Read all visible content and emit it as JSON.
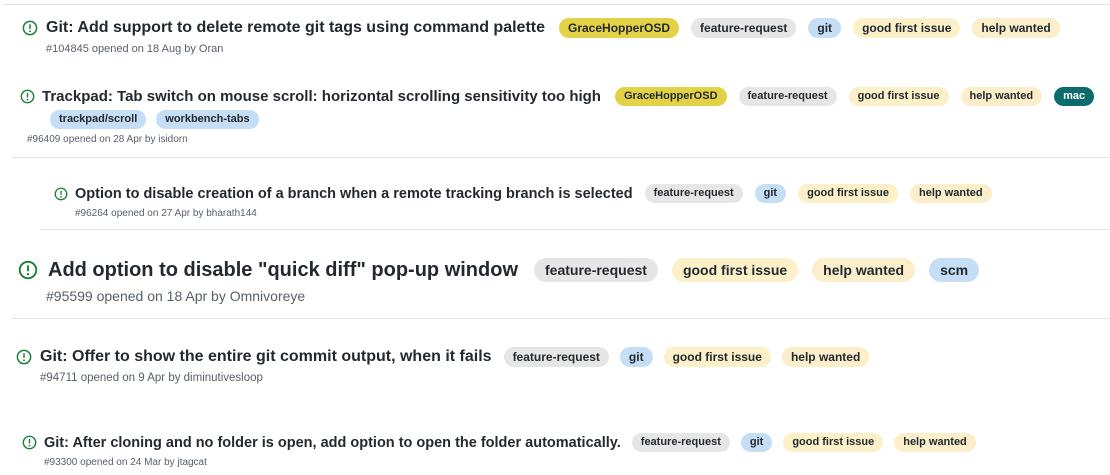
{
  "colors": {
    "open_icon": "#1a7f37",
    "label_gracehopper": "#e4d246",
    "label_feature_request": "#e6e6e6",
    "label_git": "#c5def5",
    "label_good_first_issue": "#fbf0c8",
    "label_help_wanted": "#fbeecb",
    "label_trackpad": "#c5def5",
    "label_workbench_tabs": "#c5def5",
    "label_scm": "#c5def5",
    "label_mac_dark": "#0e6b6b",
    "title_text": "#24292f",
    "meta_text": "#57606a"
  },
  "issues": [
    {
      "icon": "issue-open-icon",
      "title": "Git: Add support to delete remote git tags using command palette",
      "labels": [
        "GraceHopperOSD",
        "feature-request",
        "git",
        "good first issue",
        "help wanted"
      ],
      "meta": "#104845 opened on 18 Aug by Oran"
    },
    {
      "icon": "issue-open-icon",
      "title": "Trackpad: Tab switch on mouse scroll: horizontal scrolling sensitivity too high",
      "labels": [
        "GraceHopperOSD",
        "feature-request",
        "good first issue",
        "help wanted",
        "mac"
      ],
      "labels_second_row": [
        "trackpad/scroll",
        "workbench-tabs"
      ],
      "meta": "#96409 opened on 28 Apr by isidorn"
    },
    {
      "icon": "issue-open-icon",
      "title": "Option to disable creation of a branch when a remote tracking branch is selected",
      "labels": [
        "feature-request",
        "git",
        "good first issue",
        "help wanted"
      ],
      "meta": "#96264 opened on 27 Apr by bharath144"
    },
    {
      "icon": "issue-open-icon",
      "title": "Add option to disable \"quick diff\" pop-up window",
      "labels": [
        "feature-request",
        "good first issue",
        "help wanted",
        "scm"
      ],
      "meta": "#95599 opened on 18 Apr by Omnivoreye"
    },
    {
      "icon": "issue-open-icon",
      "title": "Git: Offer to show the entire git commit output, when it fails",
      "labels": [
        "feature-request",
        "git",
        "good first issue",
        "help wanted"
      ],
      "meta": "#94711 opened on 9 Apr by diminutivesloop"
    },
    {
      "icon": "issue-open-icon",
      "title": "Git: After cloning and no folder is open, add option to open the folder automatically.",
      "labels": [
        "feature-request",
        "git",
        "good first issue",
        "help wanted"
      ],
      "meta": "#93300 opened on 24 Mar by jtagcat"
    }
  ]
}
